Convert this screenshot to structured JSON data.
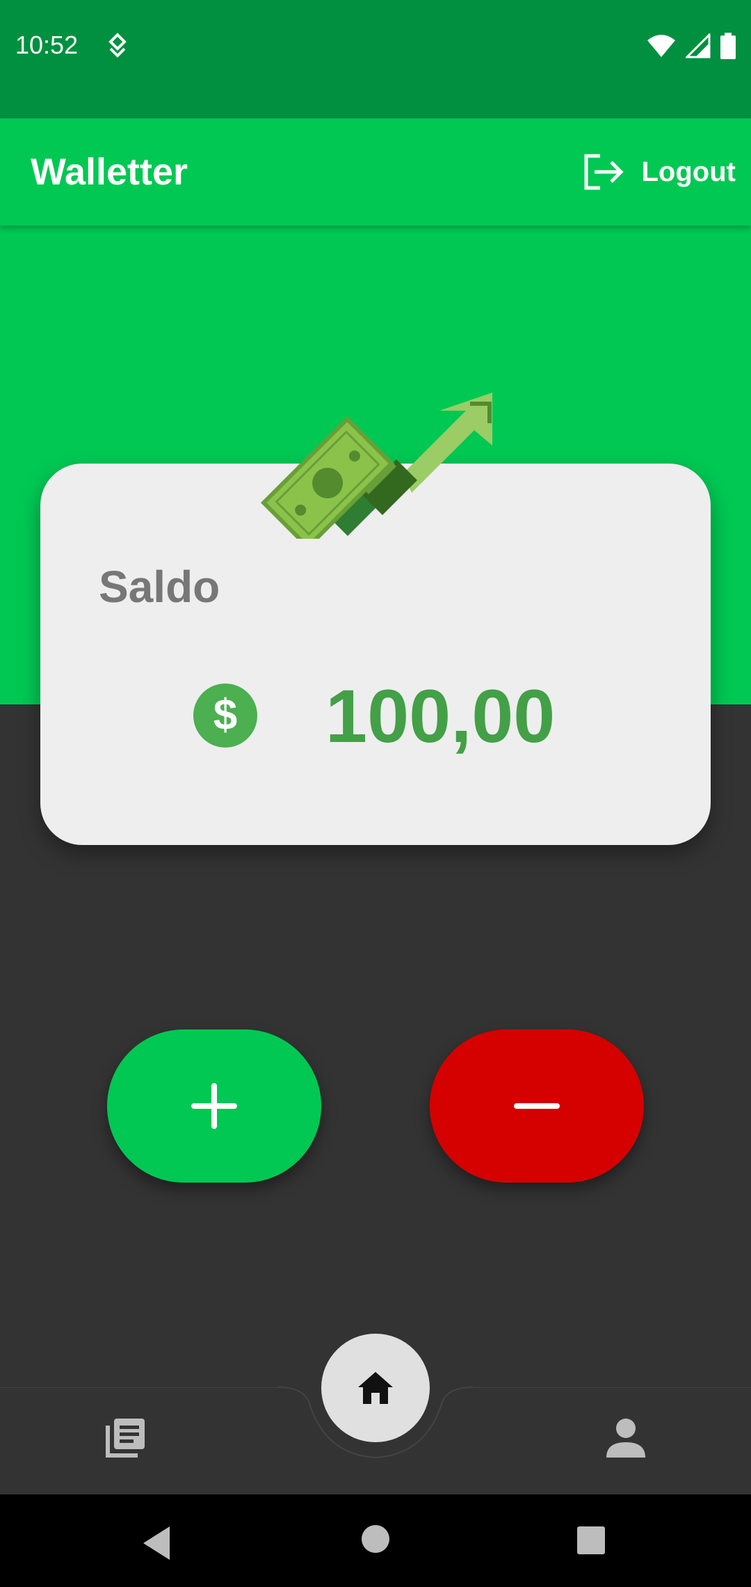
{
  "status_bar": {
    "time": "10:52",
    "icons": [
      "notification-icon",
      "wifi-icon",
      "signal-icon",
      "battery-icon"
    ]
  },
  "app_bar": {
    "title": "Walletter",
    "logout_label": "Logout",
    "logout_icon": "logout-icon"
  },
  "balance_card": {
    "label": "Saldo",
    "currency_icon": "dollar-icon",
    "value": "100,00"
  },
  "actions": {
    "add_icon": "plus-icon",
    "subtract_icon": "minus-icon"
  },
  "bottom_nav": {
    "items": [
      "list-icon",
      "home-icon",
      "person-icon"
    ]
  },
  "colors": {
    "primary": "#00C853",
    "status_bar": "#009040",
    "danger": "#D50000",
    "background": "#333333",
    "card": "#EEEEEE",
    "balance_text": "#43A047"
  }
}
